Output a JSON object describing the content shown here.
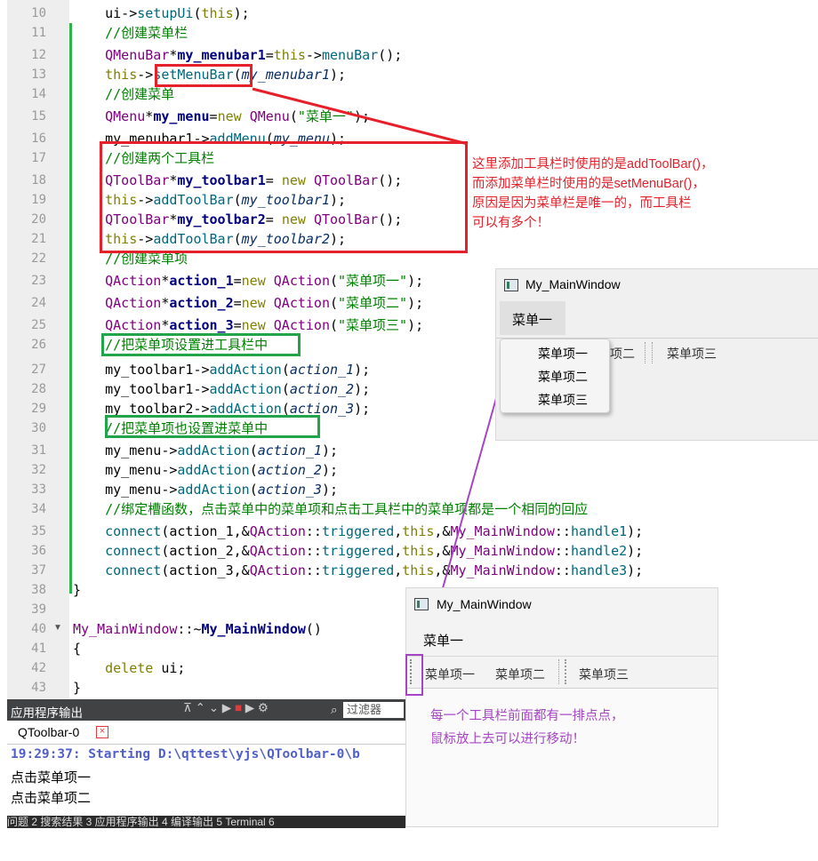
{
  "code_lines": [
    {
      "n": "10",
      "parts": [
        [
          "p",
          "    ui->"
        ],
        [
          "f",
          "setupUi"
        ],
        [
          "p",
          "("
        ],
        [
          "k",
          "this"
        ],
        [
          "p",
          ");"
        ]
      ]
    },
    {
      "n": "11",
      "parts": [
        [
          "c",
          "    //创建菜单栏"
        ]
      ]
    },
    {
      "n": "12",
      "parts": [
        [
          "t",
          "    QMenuBar"
        ],
        [
          "p",
          "*"
        ],
        [
          "b",
          "my_menubar1"
        ],
        [
          "p",
          "="
        ],
        [
          "k",
          "this"
        ],
        [
          "p",
          "->"
        ],
        [
          "f",
          "menuBar"
        ],
        [
          "p",
          "();"
        ]
      ]
    },
    {
      "n": "13",
      "parts": [
        [
          "k",
          "    this"
        ],
        [
          "p",
          "->"
        ],
        [
          "f",
          "setMenuBar"
        ],
        [
          "p",
          "("
        ],
        [
          "v",
          "my_menubar1"
        ],
        [
          "p",
          ");"
        ]
      ]
    },
    {
      "n": "14",
      "parts": [
        [
          "c",
          "    //创建菜单"
        ]
      ]
    },
    {
      "n": "15",
      "parts": [
        [
          "t",
          "    QMenu"
        ],
        [
          "p",
          "*"
        ],
        [
          "b",
          "my_menu"
        ],
        [
          "p",
          "="
        ],
        [
          "k",
          "new "
        ],
        [
          "t",
          "QMenu"
        ],
        [
          "p",
          "("
        ],
        [
          "s",
          "\"菜单一\""
        ],
        [
          "p",
          ");"
        ]
      ]
    },
    {
      "n": "16",
      "parts": [
        [
          "p",
          "    my_menubar1->"
        ],
        [
          "f",
          "addMenu"
        ],
        [
          "p",
          "("
        ],
        [
          "v",
          "my_menu"
        ],
        [
          "p",
          ");"
        ]
      ]
    },
    {
      "n": "17",
      "parts": [
        [
          "c",
          "    //创建两个工具栏"
        ]
      ]
    },
    {
      "n": "18",
      "parts": [
        [
          "t",
          "    QToolBar"
        ],
        [
          "p",
          "*"
        ],
        [
          "b",
          "my_toolbar1"
        ],
        [
          "p",
          "= "
        ],
        [
          "k",
          "new "
        ],
        [
          "t",
          "QToolBar"
        ],
        [
          "p",
          "();"
        ]
      ]
    },
    {
      "n": "19",
      "parts": [
        [
          "k",
          "    this"
        ],
        [
          "p",
          "->"
        ],
        [
          "f",
          "addToolBar"
        ],
        [
          "p",
          "("
        ],
        [
          "v",
          "my_toolbar1"
        ],
        [
          "p",
          ");"
        ]
      ]
    },
    {
      "n": "20",
      "parts": [
        [
          "t",
          "    QToolBar"
        ],
        [
          "p",
          "*"
        ],
        [
          "b",
          "my_toolbar2"
        ],
        [
          "p",
          "= "
        ],
        [
          "k",
          "new "
        ],
        [
          "t",
          "QToolBar"
        ],
        [
          "p",
          "();"
        ]
      ]
    },
    {
      "n": "21",
      "parts": [
        [
          "k",
          "    this"
        ],
        [
          "p",
          "->"
        ],
        [
          "f",
          "addToolBar"
        ],
        [
          "p",
          "("
        ],
        [
          "v",
          "my_toolbar2"
        ],
        [
          "p",
          ");"
        ]
      ]
    },
    {
      "n": "22",
      "parts": [
        [
          "c",
          "    //创建菜单项"
        ]
      ]
    },
    {
      "n": "23",
      "parts": [
        [
          "t",
          "    QAction"
        ],
        [
          "p",
          "*"
        ],
        [
          "b",
          "action_1"
        ],
        [
          "p",
          "="
        ],
        [
          "k",
          "new "
        ],
        [
          "t",
          "QAction"
        ],
        [
          "p",
          "("
        ],
        [
          "s",
          "\"菜单项一\""
        ],
        [
          "p",
          ");"
        ]
      ]
    },
    {
      "n": "24",
      "parts": [
        [
          "t",
          "    QAction"
        ],
        [
          "p",
          "*"
        ],
        [
          "b",
          "action_2"
        ],
        [
          "p",
          "="
        ],
        [
          "k",
          "new "
        ],
        [
          "t",
          "QAction"
        ],
        [
          "p",
          "("
        ],
        [
          "s",
          "\"菜单项二\""
        ],
        [
          "p",
          ");"
        ]
      ]
    },
    {
      "n": "25",
      "parts": [
        [
          "t",
          "    QAction"
        ],
        [
          "p",
          "*"
        ],
        [
          "b",
          "action_3"
        ],
        [
          "p",
          "="
        ],
        [
          "k",
          "new "
        ],
        [
          "t",
          "QAction"
        ],
        [
          "p",
          "("
        ],
        [
          "s",
          "\"菜单项三\""
        ],
        [
          "p",
          ");"
        ]
      ]
    },
    {
      "n": "26",
      "parts": [
        [
          "c",
          "    //把菜单项设置进工具栏中"
        ]
      ]
    },
    {
      "n": "27",
      "parts": [
        [
          "p",
          "    my_toolbar1->"
        ],
        [
          "f",
          "addAction"
        ],
        [
          "p",
          "("
        ],
        [
          "v",
          "action_1"
        ],
        [
          "p",
          ");"
        ]
      ]
    },
    {
      "n": "28",
      "parts": [
        [
          "p",
          "    my_toolbar1->"
        ],
        [
          "f",
          "addAction"
        ],
        [
          "p",
          "("
        ],
        [
          "v",
          "action_2"
        ],
        [
          "p",
          ");"
        ]
      ]
    },
    {
      "n": "29",
      "parts": [
        [
          "p",
          "    my_toolbar2->"
        ],
        [
          "f",
          "addAction"
        ],
        [
          "p",
          "("
        ],
        [
          "v",
          "action_3"
        ],
        [
          "p",
          ");"
        ]
      ]
    },
    {
      "n": "30",
      "parts": [
        [
          "c",
          "    //把菜单项也设置进菜单中"
        ]
      ]
    },
    {
      "n": "31",
      "parts": [
        [
          "p",
          "    my_menu->"
        ],
        [
          "f",
          "addAction"
        ],
        [
          "p",
          "("
        ],
        [
          "v",
          "action_1"
        ],
        [
          "p",
          ");"
        ]
      ]
    },
    {
      "n": "32",
      "parts": [
        [
          "p",
          "    my_menu->"
        ],
        [
          "f",
          "addAction"
        ],
        [
          "p",
          "("
        ],
        [
          "v",
          "action_2"
        ],
        [
          "p",
          ");"
        ]
      ]
    },
    {
      "n": "33",
      "parts": [
        [
          "p",
          "    my_menu->"
        ],
        [
          "f",
          "addAction"
        ],
        [
          "p",
          "("
        ],
        [
          "v",
          "action_3"
        ],
        [
          "p",
          ");"
        ]
      ]
    },
    {
      "n": "34",
      "parts": [
        [
          "c",
          "    //绑定槽函数，点击菜单中的菜单项和点击工具栏中的菜单项都是一个相同的回应"
        ]
      ]
    },
    {
      "n": "35",
      "parts": [
        [
          "f",
          "    connect"
        ],
        [
          "p",
          "(action_1,&"
        ],
        [
          "t",
          "QAction"
        ],
        [
          "p",
          "::"
        ],
        [
          "f",
          "triggered"
        ],
        [
          "p",
          ","
        ],
        [
          "k",
          "this"
        ],
        [
          "p",
          ",&"
        ],
        [
          "t",
          "My_MainWindow"
        ],
        [
          "p",
          "::"
        ],
        [
          "f",
          "handle1"
        ],
        [
          "p",
          ");"
        ]
      ]
    },
    {
      "n": "36",
      "parts": [
        [
          "f",
          "    connect"
        ],
        [
          "p",
          "(action_2,&"
        ],
        [
          "t",
          "QAction"
        ],
        [
          "p",
          "::"
        ],
        [
          "f",
          "triggered"
        ],
        [
          "p",
          ","
        ],
        [
          "k",
          "this"
        ],
        [
          "p",
          ",&"
        ],
        [
          "t",
          "My_MainWindow"
        ],
        [
          "p",
          "::"
        ],
        [
          "f",
          "handle2"
        ],
        [
          "p",
          ");"
        ]
      ]
    },
    {
      "n": "37",
      "parts": [
        [
          "f",
          "    connect"
        ],
        [
          "p",
          "(action_3,&"
        ],
        [
          "t",
          "QAction"
        ],
        [
          "p",
          "::"
        ],
        [
          "f",
          "triggered"
        ],
        [
          "p",
          ","
        ],
        [
          "k",
          "this"
        ],
        [
          "p",
          ",&"
        ],
        [
          "t",
          "My_MainWindow"
        ],
        [
          "p",
          "::"
        ],
        [
          "f",
          "handle3"
        ],
        [
          "p",
          ");"
        ]
      ]
    },
    {
      "n": "38",
      "parts": [
        [
          "p",
          "}"
        ]
      ]
    },
    {
      "n": "39",
      "parts": []
    },
    {
      "n": "40",
      "parts": [
        [
          "t",
          "My_MainWindow"
        ],
        [
          "p",
          "::~"
        ],
        [
          "b",
          "My_MainWindow"
        ],
        [
          "p",
          "()"
        ]
      ]
    },
    {
      "n": "41",
      "parts": [
        [
          "p",
          "{"
        ]
      ]
    },
    {
      "n": "42",
      "parts": [
        [
          "k",
          "    delete "
        ],
        [
          "p",
          "ui;"
        ]
      ]
    },
    {
      "n": "43",
      "parts": [
        [
          "p",
          "}"
        ]
      ]
    }
  ],
  "annotations": {
    "red_note": [
      "这里添加工具栏时使用的是addToolBar()，",
      "而添加菜单栏时使用的是setMenuBar()，",
      "原因是因为菜单栏是唯一的，而工具栏",
      "可以有多个！"
    ],
    "purple_note": [
      "每一个工具栏前面都有一排点点，",
      "鼠标放上去可以进行移动！"
    ]
  },
  "window_top": {
    "title": "My_MainWindow",
    "menu": "菜单一",
    "dropdown": [
      "菜单项一",
      "菜单项二",
      "菜单项三"
    ],
    "toolbar_partial": "项二",
    "toolbar_item3": "菜单项三"
  },
  "window_bottom": {
    "title": "My_MainWindow",
    "menu": "菜单一",
    "toolbar1": [
      "菜单项一",
      "菜单项二"
    ],
    "toolbar2": [
      "菜单项三"
    ]
  },
  "output_panel": {
    "title": "应用程序输出",
    "filter_placeholder": "过滤器",
    "tab": "QToolbar-0",
    "start_line": "19:29:37: Starting D:\\qttest\\yjs\\QToolbar-0\\b",
    "lines": [
      "点击菜单项一",
      "点击菜单项二"
    ],
    "bottom_tabs": "问题  2 搜索结果  3 应用程序输出  4 编译输出  5 Terminal  6"
  },
  "colors": {
    "red": "#e5202a",
    "green": "#22a44a",
    "purple": "#a545c5"
  }
}
